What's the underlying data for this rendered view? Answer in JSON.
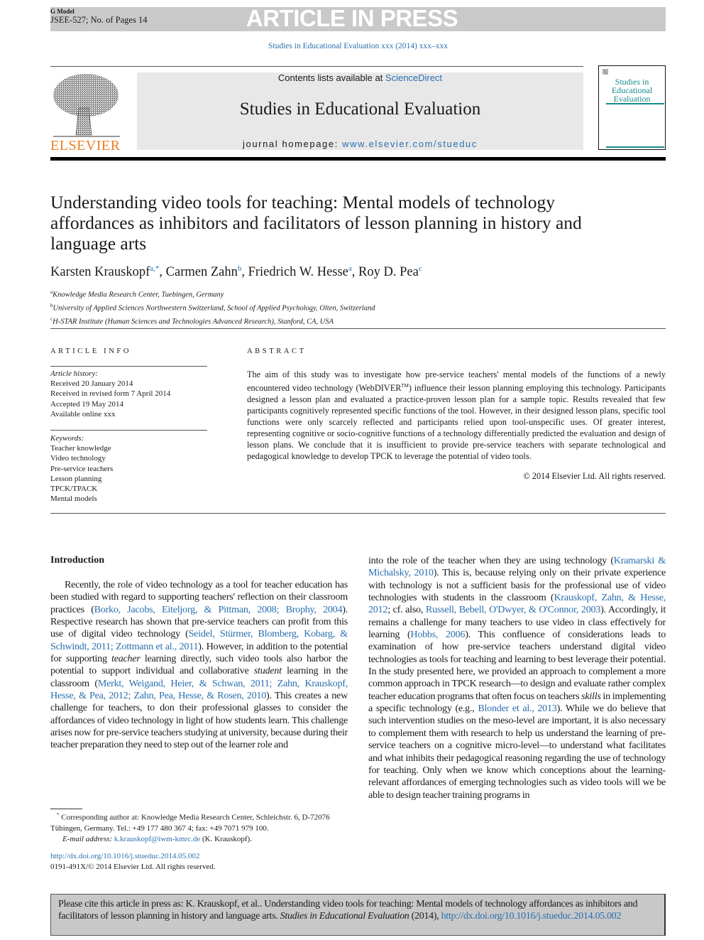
{
  "header": {
    "g_model": "G Model",
    "article_id": "JSEE-527; No. of Pages 14",
    "banner": "ARTICLE IN PRESS",
    "journal_ref": "Studies in Educational Evaluation xxx (2014) xxx–xxx",
    "contents_prefix": "Contents lists available at ",
    "contents_link": "ScienceDirect",
    "journal_title": "Studies in Educational Evaluation",
    "homepage_prefix": "journal homepage: ",
    "homepage_link": "www.elsevier.com/stueduc",
    "publisher_logo": "ELSEVIER",
    "cover_title": "Studies in Educational Evaluation",
    "colors": {
      "banner_bg": "#c9c9c9",
      "link": "#2a6fae",
      "elsevier": "#f07c1e",
      "cover_accent": "#1a8a8a"
    }
  },
  "article": {
    "title": "Understanding video tools for teaching: Mental models of technology affordances as inhibitors and facilitators of lesson planning in history and language arts",
    "authors": [
      {
        "name": "Karsten Krauskopf",
        "sup": "a,*",
        "sep": ", "
      },
      {
        "name": "Carmen Zahn",
        "sup": "b",
        "sep": ", "
      },
      {
        "name": "Friedrich W. Hesse",
        "sup": "a",
        "sep": ", "
      },
      {
        "name": "Roy D. Pea",
        "sup": "c",
        "sep": ""
      }
    ],
    "affiliations": [
      {
        "sup": "a",
        "text": "Knowledge Media Research Center, Tuebingen, Germany"
      },
      {
        "sup": "b",
        "text": "University of Applied Sciences Northwestern Switzerland, School of Applied Psychology, Olten, Switzerland"
      },
      {
        "sup": "c",
        "text": "H-STAR Institute (Human Sciences and Technologies Advanced Research), Stanford, CA, USA"
      }
    ]
  },
  "article_info": {
    "heading": "ARTICLE INFO",
    "history_label": "Article history:",
    "history": [
      "Received 20 January 2014",
      "Received in revised form 7 April 2014",
      "Accepted 19 May 2014",
      "Available online xxx"
    ],
    "keywords_label": "Keywords:",
    "keywords": [
      "Teacher knowledge",
      "Video technology",
      "Pre-service teachers",
      "Lesson planning",
      "TPCK/TPACK",
      "Mental models"
    ]
  },
  "abstract": {
    "heading": "ABSTRACT",
    "segments": [
      {
        "t": "The aim of this study was to investigate how pre-service teachers' mental models of the functions of a newly encountered video technology (WebDIVER"
      },
      {
        "s": "TM"
      },
      {
        "t": ") influence their lesson planning employing this technology. Participants designed a lesson plan and evaluated a practice-proven lesson plan for a sample topic. Results revealed that few participants cognitively represented specific functions of the tool. However, in their designed lesson plans, specific tool functions were only scarcely reflected and participants relied upon tool-unspecific uses. Of greater interest, representing cognitive or socio-cognitive functions of a technology differentially predicted the evaluation and design of lesson plans. We conclude that it is insufficient to provide pre-service teachers with separate technological and pedagogical knowledge to develop TPCK to leverage the potential of video tools."
      }
    ],
    "copyright": "© 2014 Elsevier Ltd. All rights reserved."
  },
  "intro": {
    "heading": "Introduction",
    "left": [
      {
        "t": "Recently, the role of video technology as a tool for teacher education has been studied with regard to supporting teachers' reflection on their classroom practices ("
      },
      {
        "l": "Borko, Jacobs, Eiteljorg, & Pittman, 2008; Brophy, 2004"
      },
      {
        "t": "). Respective research has shown that pre-service teachers can profit from this use of digital video technology ("
      },
      {
        "l": "Seidel, Stürmer, Blomberg, Kobarg, & Schwindt, 2011; Zottmann et al., 2011"
      },
      {
        "t": "). However, in addition to the potential for supporting "
      },
      {
        "i": "teacher"
      },
      {
        "t": " learning directly, such video tools also harbor the potential to support individual and collaborative "
      },
      {
        "i": "student"
      },
      {
        "t": " learning in the classroom ("
      },
      {
        "l": "Merkt, Weigand, Heier, & Schwan, 2011; Zahn, Krauskopf, Hesse, & Pea, 2012; Zahn, Pea, Hesse, & Rosen, 2010"
      },
      {
        "t": "). This creates a new challenge for teachers, to don their professional glasses to consider the affordances of video technology in light of how students learn. This challenge arises now for pre-service teachers studying at university, because during their teacher preparation they need to step out of the learner role and"
      }
    ],
    "right": [
      {
        "t": "into the role of the teacher when they are using technology ("
      },
      {
        "l": "Kramarski & Michalsky, 2010"
      },
      {
        "t": "). This is, because relying only on their private experience with technology is not a sufficient basis for the professional use of video technologies with students in the classroom ("
      },
      {
        "l": "Krauskopf, Zahn, & Hesse, 2012"
      },
      {
        "t": "; cf. also, "
      },
      {
        "l": "Russell, Bebell, O'Dwyer, & O'Connor, 2003"
      },
      {
        "t": "). Accordingly, it remains a challenge for many teachers to use video in class effectively for learning ("
      },
      {
        "l": "Hobbs, 2006"
      },
      {
        "t": "). This confluence of considerations leads to examination of how pre-service teachers understand digital video technologies as tools for teaching and learning to best leverage their potential. In the study presented here, we provided an approach to complement a more common approach in TPCK research—to design and evaluate rather complex teacher education programs that often focus on teachers "
      },
      {
        "i": "skills"
      },
      {
        "t": " in implementing a specific technology (e.g., "
      },
      {
        "l": "Blonder et al., 2013"
      },
      {
        "t": "). While we do believe that such intervention studies on the meso-level are important, it is also necessary to complement them with research to help us understand the learning of pre-service teachers on a cognitive micro-level—to understand what facilitates and what inhibits their pedagogical reasoning regarding the use of technology for teaching. Only when we know which conceptions about the learning-relevant affordances of emerging technologies such as video tools will we be able to design teacher training programs in"
      }
    ]
  },
  "footnote": {
    "star": "*",
    "text": " Corresponding author at: Knowledge Media Research Center, Schleichstr. 6, D-72076 Tübingen, Germany. Tel.: +49 177 480 367 4; fax: +49 7071 979 100.",
    "email_label": "E-mail address: ",
    "email": "k.krauskopf@iwm-kmrc.de",
    "email_suffix": " (K. Krauskopf).",
    "doi": "http://dx.doi.org/10.1016/j.stueduc.2014.05.002",
    "issn": "0191-491X/© 2014 Elsevier Ltd. All rights reserved."
  },
  "cite": {
    "prefix": "Please cite this article in press as: K. Krauskopf, et al.. Understanding video tools for teaching: Mental models of technology affordances as inhibitors and facilitators of lesson planning in history and language arts. ",
    "journal": "Studies in Educational Evaluation",
    "year": " (2014), ",
    "link": "http://dx.doi.org/10.1016/j.stueduc.2014.05.002"
  }
}
